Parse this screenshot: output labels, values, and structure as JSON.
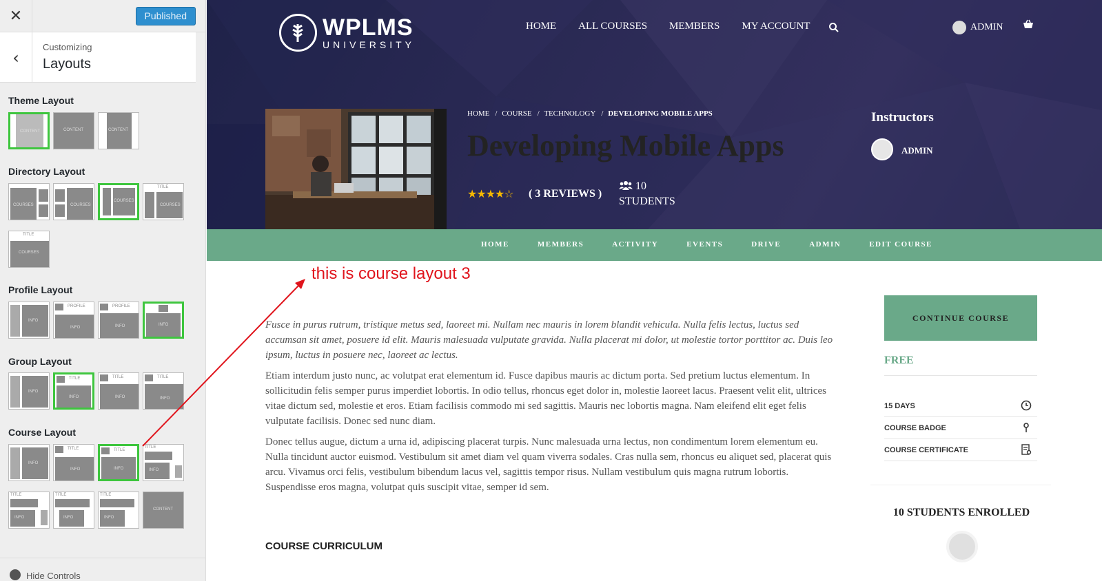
{
  "customizer": {
    "close_icon": "close-icon",
    "publish_label": "Published",
    "subheading": "Customizing",
    "title": "Layouts",
    "sections": {
      "theme": "Theme Layout",
      "directory": "Directory Layout",
      "profile": "Profile Layout",
      "group": "Group Layout",
      "course": "Course Layout"
    },
    "thumb_labels": {
      "content": "CONTENT",
      "courses": "COURSES",
      "profile": "PROFILE",
      "info": "INFO",
      "title": "TITLE",
      "sidebar": "SIDEBAR"
    },
    "footer": "Hide Controls",
    "selected_color": "#3ec63e"
  },
  "site": {
    "logo_main": "WPLMS",
    "logo_sub": "UNIVERSITY",
    "nav": [
      "HOME",
      "ALL COURSES",
      "MEMBERS",
      "MY ACCOUNT"
    ],
    "user": "ADMIN",
    "breadcrumb": [
      "HOME",
      "COURSE",
      "TECHNOLOGY",
      "DEVELOPING MOBILE APPS"
    ],
    "course_title": "Developing Mobile Apps",
    "rating_stars": "★★★★☆",
    "rating": 4,
    "reviews": "( 3 REVIEWS )",
    "students_count": "10",
    "students_label": "STUDENTS",
    "instructors_heading": "Instructors",
    "instructor_name": "ADMIN",
    "subnav": [
      "HOME",
      "MEMBERS",
      "ACTIVITY",
      "EVENTS",
      "DRIVE",
      "ADMIN",
      "EDIT COURSE"
    ],
    "annotation": "this is course layout 3",
    "description": [
      "Fusce in purus rutrum, tristique metus sed, laoreet mi. Nullam nec mauris in lorem blandit vehicula. Nulla felis lectus, luctus sed accumsan sit amet, posuere id elit. Mauris malesuada vulputate gravida. Nulla placerat mi dolor, ut molestie tortor porttitor ac. Duis leo ipsum, luctus in posuere nec, laoreet ac lectus.",
      "Etiam interdum justo nunc, ac volutpat erat elementum id. Fusce dapibus mauris ac dictum porta. Sed pretium luctus elementum. In sollicitudin felis semper purus imperdiet lobortis. In odio tellus, rhoncus eget dolor in, molestie laoreet lacus. Praesent velit elit, ultrices vitae dictum sed, molestie et eros. Etiam facilisis commodo mi sed sagittis. Mauris nec lobortis magna. Nam eleifend elit eget felis vulputate facilisis. Donec sed nunc diam.",
      "Donec tellus augue, dictum a urna id, adipiscing placerat turpis. Nunc malesuada urna lectus, non condimentum lorem elementum eu. Nulla tincidunt auctor euismod. Vestibulum sit amet diam vel quam viverra sodales. Cras nulla sem, rhoncus eu aliquet sed, placerat quis arcu. Vivamus orci felis, vestibulum bibendum lacus vel, sagittis tempor risus. Nullam vestibulum quis magna rutrum lobortis. Suspendisse eros magna, volutpat quis suscipit vitae, semper id sem."
    ],
    "curriculum_heading": "COURSE CURRICULUM",
    "continue_button": "CONTINUE COURSE",
    "price": "FREE",
    "details": [
      "15 DAYS",
      "COURSE BADGE",
      "COURSE CERTIFICATE"
    ],
    "enrolled": "10 STUDENTS ENROLLED",
    "accent_color": "#6aa989",
    "annotation_color": "#e0141c"
  }
}
